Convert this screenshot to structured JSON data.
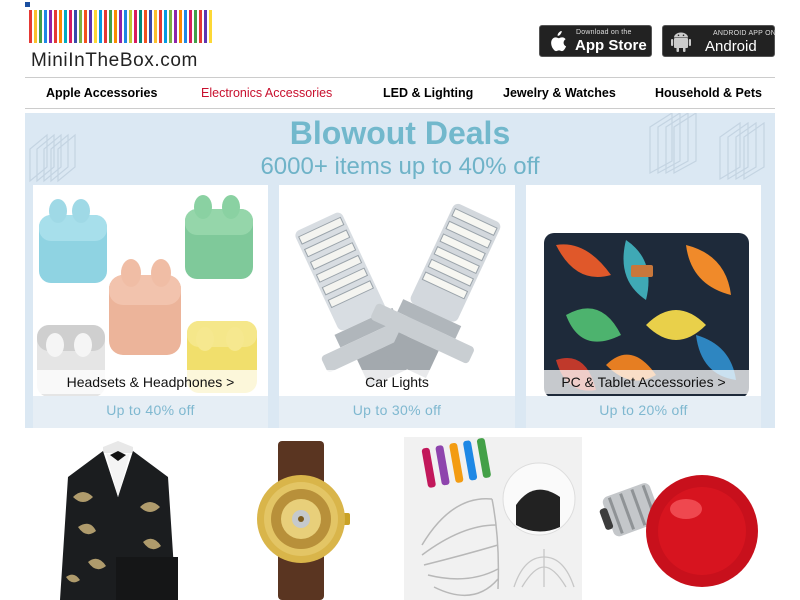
{
  "header": {
    "logo_text": "MiniInTheBox.com",
    "app_store": {
      "small": "Download on the",
      "big": "App Store"
    },
    "android": {
      "small": "ANDROID APP ON",
      "big": "Android"
    }
  },
  "nav": {
    "items": [
      {
        "label": "Apple Accessories",
        "active": false
      },
      {
        "label": "Electronics Accessories",
        "active": true
      },
      {
        "label": "LED & Lighting",
        "active": false
      },
      {
        "label": "Jewelry & Watches",
        "active": false
      },
      {
        "label": "Household & Pets",
        "active": false
      }
    ]
  },
  "banner": {
    "title": "Blowout Deals",
    "subtitle": "6000+ items up to 40% off",
    "cards": [
      {
        "label": "Headsets & Headphones >",
        "discount": "Up to 40% off"
      },
      {
        "label": "Car Lights",
        "discount": "Up to 30% off"
      },
      {
        "label": "PC & Tablet Accessories >",
        "discount": "Up to 20% off"
      }
    ]
  },
  "colors": {
    "accent_red": "#c8102e",
    "banner_bg": "#dbe8f3",
    "banner_text": "#72b8cc"
  }
}
